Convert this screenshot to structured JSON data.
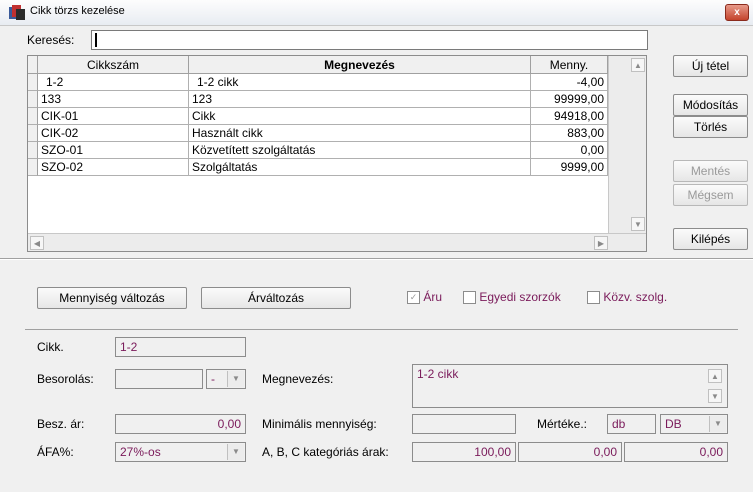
{
  "window": {
    "title": "Cikk törzs kezelése",
    "close_glyph": "x"
  },
  "search": {
    "label": "Keresés:",
    "value": ""
  },
  "buttons": {
    "new_item": "Új tétel",
    "modify": "Módosítás",
    "delete": "Törlés",
    "save": "Mentés",
    "cancel": "Mégsem",
    "exit": "Kilépés",
    "qty_change": "Mennyiség változás",
    "price_change": "Árváltozás"
  },
  "grid": {
    "columns": [
      "Cikkszám",
      "Megnevezés",
      "Menny."
    ],
    "rows": [
      {
        "code": "1-2",
        "name": "1-2 cikk",
        "qty": "-4,00"
      },
      {
        "code": "133",
        "name": "123",
        "qty": "99999,00"
      },
      {
        "code": "CIK-01",
        "name": "Cikk",
        "qty": "94918,00"
      },
      {
        "code": "CIK-02",
        "name": "Használt cikk",
        "qty": "883,00"
      },
      {
        "code": "SZO-01",
        "name": "Közvetített szolgáltatás",
        "qty": "0,00"
      },
      {
        "code": "SZO-02",
        "name": "Szolgáltatás",
        "qty": "9999,00"
      }
    ]
  },
  "checkboxes": {
    "aru": {
      "label": "Áru",
      "checked": true
    },
    "egyedi": {
      "label": "Egyedi szorzók",
      "checked": false
    },
    "kozv": {
      "label": "Közv. szolg.",
      "checked": false
    }
  },
  "detail": {
    "cikk_label": "Cikk.",
    "cikk_value": "1-2",
    "besorolas_label": "Besorolás:",
    "besorolas_value": "",
    "besorolas_sub": "-",
    "megnevezes_label": "Megnevezés:",
    "megnevezes_value": "1-2 cikk",
    "besz_ar_label": "Besz. ár:",
    "besz_ar_value": "0,00",
    "min_qty_label": "Minimális mennyiség:",
    "min_qty_value": "",
    "merteke_label": "Mértéke.:",
    "merteke_value": "db",
    "merteke_combo": "DB",
    "afa_label": "ÁFA%:",
    "afa_value": "27%-os",
    "abc_label": "A, B, C kategóriás árak:",
    "abc_values": [
      "100,00",
      "0,00",
      "0,00"
    ]
  },
  "colors": {
    "accent": "#7a1a5a",
    "close": "#c4432c"
  }
}
